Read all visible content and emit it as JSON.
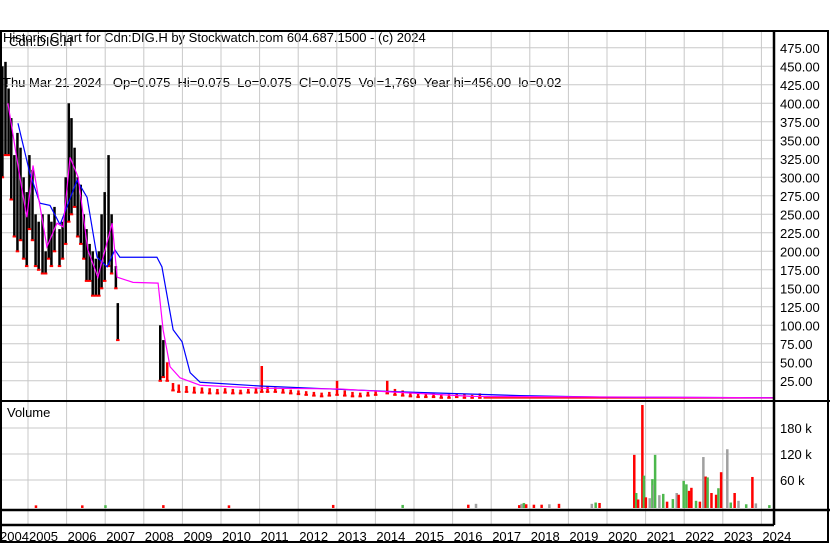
{
  "header": {
    "title": "Historic Chart for Cdn:DIG.H by Stockwatch.com 604.687.1500 - (c) 2024",
    "quote": "Thu Mar 21 2024   Op=0.075  Hi=0.075  Lo=0.075  Cl=0.075  Vol=1,769  Year hi=456.00  lo=0.02"
  },
  "chart_data": {
    "type": "bar",
    "symbol": "Cdn:DIG.H",
    "volume_label": "Volume",
    "price_axis": {
      "range": [
        0,
        480
      ],
      "ticks": [
        "475.00",
        "450.00",
        "425.00",
        "400.00",
        "375.00",
        "350.00",
        "325.00",
        "300.00",
        "275.00",
        "250.00",
        "225.00",
        "200.00",
        "175.00",
        "150.00",
        "125.00",
        "100.00",
        "75.00",
        "50.00",
        "25.00"
      ],
      "tick_values": [
        475,
        450,
        425,
        400,
        375,
        350,
        325,
        300,
        275,
        250,
        225,
        200,
        175,
        150,
        125,
        100,
        75,
        50,
        25
      ]
    },
    "volume_axis": {
      "range": [
        0,
        240000
      ],
      "ticks": [
        "180 k",
        "120 k",
        "60 k"
      ],
      "tick_values": [
        180000,
        120000,
        60000
      ]
    },
    "x_axis": {
      "range": [
        2004.27,
        2024.32
      ],
      "years": [
        "2004",
        "2005",
        "2006",
        "2007",
        "2008",
        "2009",
        "2010",
        "2011",
        "2012",
        "2013",
        "2014",
        "2015",
        "2016",
        "2017",
        "2018",
        "2019",
        "2020",
        "2021",
        "2022",
        "2023",
        "2024"
      ]
    },
    "price_bars": [
      [
        2004.33,
        450,
        300
      ],
      [
        2004.41,
        456,
        330
      ],
      [
        2004.49,
        420,
        330
      ],
      [
        2004.56,
        380,
        270
      ],
      [
        2004.64,
        330,
        220
      ],
      [
        2004.72,
        360,
        200
      ],
      [
        2004.8,
        340,
        215
      ],
      [
        2004.88,
        300,
        190
      ],
      [
        2004.96,
        280,
        180
      ],
      [
        2005.03,
        330,
        230
      ],
      [
        2005.11,
        310,
        215
      ],
      [
        2005.19,
        250,
        180
      ],
      [
        2005.27,
        240,
        175
      ],
      [
        2005.37,
        250,
        170
      ],
      [
        2005.45,
        200,
        170
      ],
      [
        2005.53,
        250,
        190
      ],
      [
        2005.6,
        240,
        180
      ],
      [
        2005.68,
        260,
        200
      ],
      [
        2005.81,
        230,
        180
      ],
      [
        2005.89,
        240,
        190
      ],
      [
        2005.97,
        300,
        210
      ],
      [
        2006.05,
        400,
        240
      ],
      [
        2006.12,
        380,
        250
      ],
      [
        2006.2,
        340,
        260
      ],
      [
        2006.28,
        300,
        220
      ],
      [
        2006.36,
        290,
        210
      ],
      [
        2006.44,
        250,
        190
      ],
      [
        2006.51,
        230,
        160
      ],
      [
        2006.59,
        210,
        160
      ],
      [
        2006.67,
        200,
        140
      ],
      [
        2006.75,
        190,
        140
      ],
      [
        2006.83,
        200,
        140
      ],
      [
        2006.9,
        250,
        150
      ],
      [
        2006.98,
        280,
        160
      ],
      [
        2007.08,
        330,
        180
      ],
      [
        2007.16,
        250,
        170
      ],
      [
        2007.27,
        180,
        150
      ],
      [
        2007.32,
        130,
        80
      ],
      [
        2008.42,
        100,
        25
      ],
      [
        2008.5,
        80,
        30
      ],
      [
        2008.6,
        50,
        25
      ],
      [
        2008.75,
        22,
        12
      ],
      [
        2008.9,
        20,
        10
      ],
      [
        2009.1,
        18,
        10
      ],
      [
        2009.3,
        17,
        9
      ],
      [
        2009.5,
        16,
        9
      ],
      [
        2009.7,
        15,
        8
      ],
      [
        2009.9,
        14,
        8
      ],
      [
        2010.1,
        15,
        9
      ],
      [
        2010.3,
        14,
        8
      ],
      [
        2010.5,
        13,
        8
      ],
      [
        2010.7,
        14,
        9
      ],
      [
        2010.9,
        15,
        9
      ],
      [
        2011.05,
        45,
        10
      ],
      [
        2011.2,
        18,
        10
      ],
      [
        2011.4,
        16,
        10
      ],
      [
        2011.6,
        15,
        9
      ],
      [
        2011.8,
        13,
        8
      ],
      [
        2012.0,
        12,
        7
      ],
      [
        2012.2,
        11,
        6
      ],
      [
        2012.4,
        10,
        5
      ],
      [
        2012.6,
        9,
        4
      ],
      [
        2012.8,
        10,
        5
      ],
      [
        2013.0,
        25,
        6
      ],
      [
        2013.2,
        12,
        5
      ],
      [
        2013.4,
        10,
        4
      ],
      [
        2013.6,
        9,
        4
      ],
      [
        2013.8,
        10,
        5
      ],
      [
        2014.0,
        12,
        6
      ],
      [
        2014.3,
        25,
        8
      ],
      [
        2014.5,
        14,
        6
      ],
      [
        2014.7,
        12,
        5
      ],
      [
        2014.9,
        10,
        4
      ],
      [
        2015.1,
        9,
        3
      ],
      [
        2015.3,
        8,
        3
      ],
      [
        2015.5,
        8,
        3
      ],
      [
        2015.7,
        7,
        2
      ],
      [
        2015.9,
        7,
        2
      ],
      [
        2016.1,
        8,
        3
      ],
      [
        2016.3,
        7,
        2
      ],
      [
        2016.5,
        6,
        2
      ],
      [
        2016.7,
        8,
        2
      ]
    ],
    "low_line": {
      "from": 2016.8,
      "to": 2024.3,
      "value": 2
    },
    "series": [
      {
        "name": "long moving average",
        "color": "#0000ff",
        "points": [
          [
            2004.74,
            373
          ],
          [
            2005.05,
            305
          ],
          [
            2005.31,
            265
          ],
          [
            2005.57,
            262
          ],
          [
            2005.83,
            236
          ],
          [
            2006.27,
            296
          ],
          [
            2006.53,
            273
          ],
          [
            2006.79,
            192
          ],
          [
            2007.05,
            179
          ],
          [
            2007.25,
            202
          ],
          [
            2007.38,
            192
          ],
          [
            2008.34,
            192
          ],
          [
            2008.47,
            179
          ],
          [
            2008.76,
            94
          ],
          [
            2008.99,
            78
          ],
          [
            2009.2,
            36
          ],
          [
            2009.46,
            23
          ],
          [
            2011.01,
            18
          ],
          [
            2012.82,
            14
          ],
          [
            2014.64,
            10
          ],
          [
            2017.75,
            5
          ],
          [
            2019.82,
            3
          ],
          [
            2024.3,
            2
          ]
        ]
      },
      {
        "name": "short moving average",
        "color": "#ff00ff",
        "points": [
          [
            2004.48,
            400
          ],
          [
            2004.79,
            300
          ],
          [
            2004.97,
            246
          ],
          [
            2005.13,
            316
          ],
          [
            2005.49,
            206
          ],
          [
            2005.75,
            238
          ],
          [
            2005.91,
            233
          ],
          [
            2006.09,
            327
          ],
          [
            2006.3,
            300
          ],
          [
            2006.55,
            202
          ],
          [
            2006.81,
            165
          ],
          [
            2007.18,
            238
          ],
          [
            2007.31,
            165
          ],
          [
            2007.72,
            158
          ],
          [
            2008.37,
            157
          ],
          [
            2008.5,
            94
          ],
          [
            2008.68,
            44
          ],
          [
            2008.94,
            29
          ],
          [
            2009.46,
            19
          ],
          [
            2011.01,
            15
          ],
          [
            2013.08,
            14
          ],
          [
            2014.38,
            10
          ],
          [
            2016.5,
            4
          ],
          [
            2024.3,
            2
          ]
        ]
      }
    ],
    "volume_bars": [
      [
        2005.2,
        1500,
        "#ff0000"
      ],
      [
        2006.4,
        1500,
        "#ff0000"
      ],
      [
        2007.0,
        1800,
        "#4cb84c"
      ],
      [
        2008.5,
        2000,
        "#ff0000"
      ],
      [
        2010.2,
        1500,
        "#ff0000"
      ],
      [
        2012.9,
        2500,
        "#ff0000"
      ],
      [
        2014.7,
        2500,
        "#4cb84c"
      ],
      [
        2016.4,
        3000,
        "#ff0000"
      ],
      [
        2016.6,
        5000,
        "#a0a0a0"
      ],
      [
        2017.72,
        2000,
        "#ff0000"
      ],
      [
        2017.78,
        5000,
        "#a0a0a0"
      ],
      [
        2017.84,
        7000,
        "#4cb84c"
      ],
      [
        2017.9,
        4000,
        "#ff0000"
      ],
      [
        2018.1,
        3000,
        "#ff0000"
      ],
      [
        2018.3,
        3000,
        "#ff0000"
      ],
      [
        2018.5,
        4000,
        "#a0a0a0"
      ],
      [
        2018.75,
        5000,
        "#ff0000"
      ],
      [
        2019.6,
        5000,
        "#a0a0a0"
      ],
      [
        2019.7,
        8000,
        "#4cb84c"
      ],
      [
        2019.8,
        7000,
        "#ff0000"
      ],
      [
        2020.7,
        118000,
        "#ff0000"
      ],
      [
        2020.75,
        30000,
        "#4cb84c"
      ],
      [
        2020.8,
        15000,
        "#ff0000"
      ],
      [
        2020.91,
        233000,
        "#ff0000"
      ],
      [
        2020.95,
        70000,
        "#4cb84c"
      ],
      [
        2021.0,
        20000,
        "#ff0000"
      ],
      [
        2021.1,
        18000,
        "#a0a0a0"
      ],
      [
        2021.17,
        62000,
        "#4cb84c"
      ],
      [
        2021.21,
        48000,
        "#a0a0a0"
      ],
      [
        2021.24,
        118000,
        "#4cb84c"
      ],
      [
        2021.35,
        25000,
        "#a0a0a0"
      ],
      [
        2021.45,
        28000,
        "#4cb84c"
      ],
      [
        2021.55,
        10000,
        "#ff0000"
      ],
      [
        2021.7,
        16000,
        "#4cb84c"
      ],
      [
        2021.8,
        30000,
        "#a0a0a0"
      ],
      [
        2021.85,
        26000,
        "#ff0000"
      ],
      [
        2021.98,
        58000,
        "#4cb84c"
      ],
      [
        2022.05,
        50000,
        "#4cb84c"
      ],
      [
        2022.12,
        35000,
        "#ff0000"
      ],
      [
        2022.18,
        42000,
        "#ff0000"
      ],
      [
        2022.3,
        12000,
        "#4cb84c"
      ],
      [
        2022.4,
        10000,
        "#ff0000"
      ],
      [
        2022.49,
        113000,
        "#a0a0a0"
      ],
      [
        2022.55,
        68000,
        "#ff0000"
      ],
      [
        2022.6,
        66000,
        "#4cb84c"
      ],
      [
        2022.7,
        30000,
        "#ff0000"
      ],
      [
        2022.82,
        26000,
        "#ff0000"
      ],
      [
        2022.88,
        41000,
        "#4cb84c"
      ],
      [
        2022.95,
        78000,
        "#ff0000"
      ],
      [
        2023.11,
        131000,
        "#a0a0a0"
      ],
      [
        2023.2,
        8000,
        "#4cb84c"
      ],
      [
        2023.3,
        30000,
        "#ff0000"
      ],
      [
        2023.4,
        12000,
        "#a0a0a0"
      ],
      [
        2023.6,
        4000,
        "#4cb84c"
      ],
      [
        2023.76,
        67000,
        "#ff0000"
      ],
      [
        2023.85,
        6000,
        "#a0a0a0"
      ],
      [
        2024.2,
        2000,
        "#4cb84c"
      ]
    ]
  }
}
